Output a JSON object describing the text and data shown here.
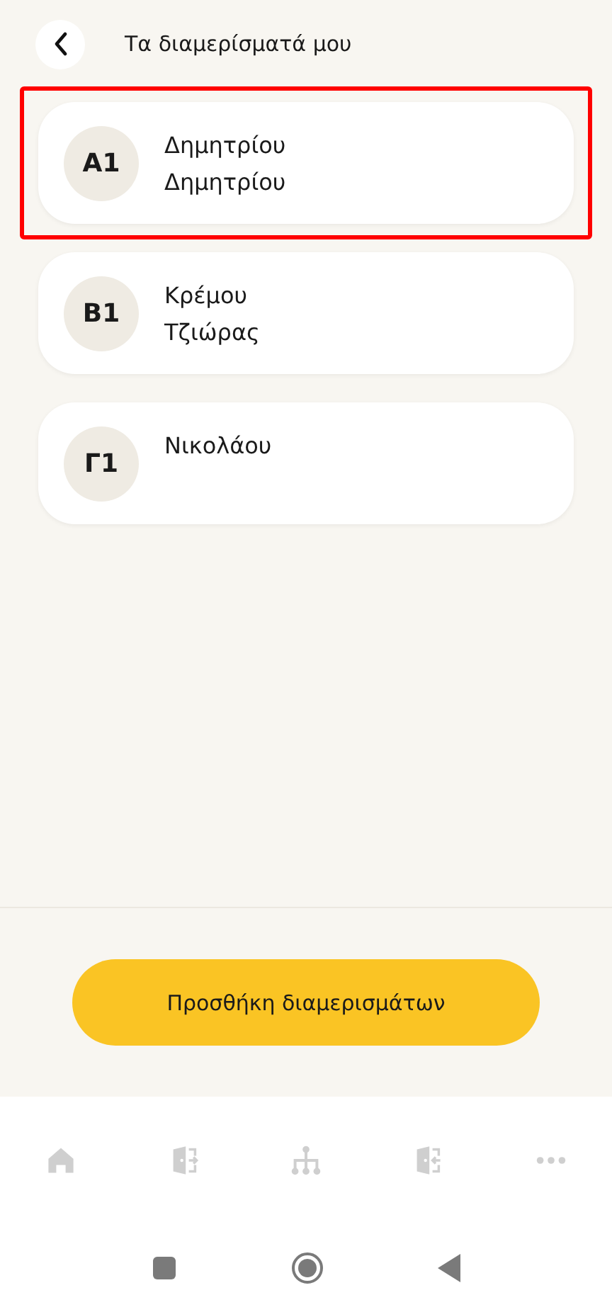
{
  "header": {
    "title": "Τα διαμερίσματά μου"
  },
  "apartments": [
    {
      "code": "A1",
      "names": [
        "Δημητρίου",
        "Δημητρίου"
      ],
      "highlighted": true
    },
    {
      "code": "B1",
      "names": [
        "Κρέμου",
        "Τζιώρας"
      ],
      "highlighted": false
    },
    {
      "code": "Γ1",
      "names": [
        "Νικολάου"
      ],
      "highlighted": false
    }
  ],
  "action_button": "Προσθήκη διαμερισμάτων",
  "tab_bar": [
    {
      "kind": "home"
    },
    {
      "kind": "exit"
    },
    {
      "kind": "tree"
    },
    {
      "kind": "enter"
    },
    {
      "kind": "more"
    }
  ]
}
